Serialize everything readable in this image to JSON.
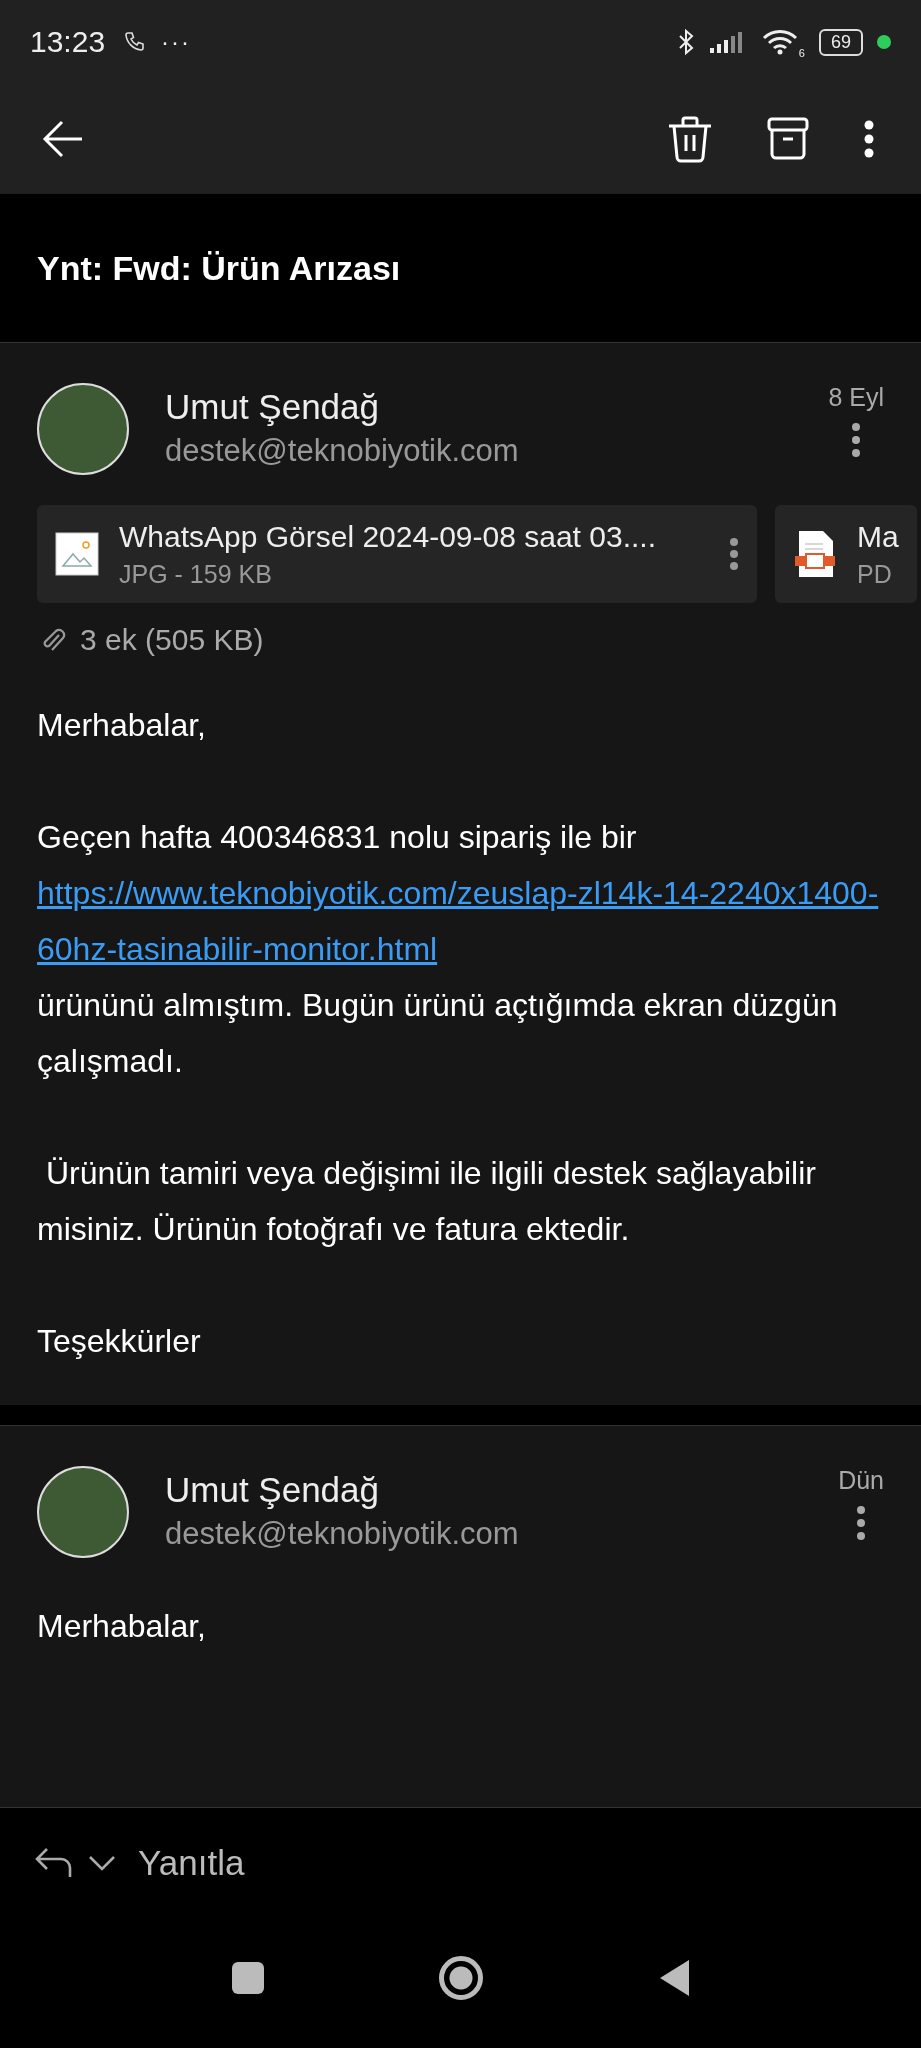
{
  "status_bar": {
    "time": "13:23",
    "more": "···",
    "battery": "69",
    "wifi_badge": "6"
  },
  "subject": "Ynt: Fwd: Ürün Arızası",
  "messages": [
    {
      "sender": "Umut Şendağ",
      "email": "destek@teknobiyotik.com",
      "date": "8 Eyl",
      "attachments": [
        {
          "name": "WhatsApp Görsel 2024-09-08 saat 03....",
          "meta": "JPG - 159 KB",
          "kind": "image"
        },
        {
          "name": "Ma",
          "meta": "PD",
          "kind": "pdf"
        }
      ],
      "attachment_summary": "3 ek (505 KB)",
      "body": [
        {
          "kind": "text",
          "text": "Merhabalar,"
        },
        {
          "kind": "link",
          "before": "Geçen hafta 400346831 nolu sipariş ile bir",
          "link": "https://www.teknobiyotik.com/zeuslap-zl14k-14-2240x1400-60hz-tasinabilir-monitor.html",
          "after": "ürününü almıştım. Bugün ürünü açtığımda ekran düzgün çalışmadı."
        },
        {
          "kind": "text",
          "text": " Ürünün tamiri veya değişimi ile ilgili destek sağlayabilir misiniz. Ürünün fotoğrafı ve fatura ektedir."
        },
        {
          "kind": "text",
          "text": "Teşekkürler"
        }
      ]
    },
    {
      "sender": "Umut Şendağ",
      "email": "destek@teknobiyotik.com",
      "date": "Dün",
      "body": [
        {
          "kind": "text",
          "text": "Merhabalar,"
        }
      ]
    }
  ],
  "reply": {
    "label": "Yanıtla"
  }
}
